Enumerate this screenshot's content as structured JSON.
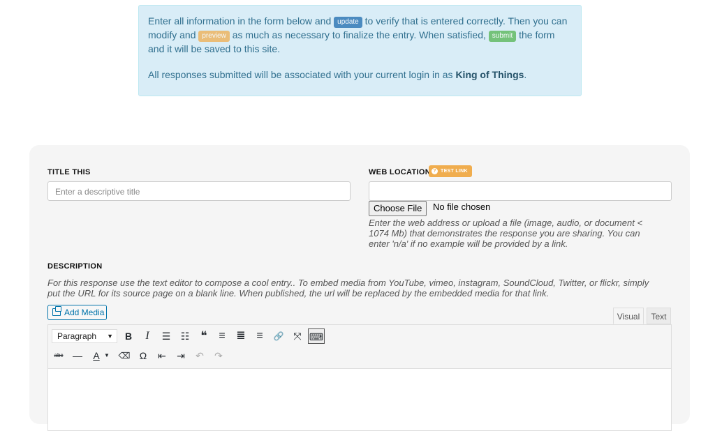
{
  "notice": {
    "line1_a": "Enter all information in the form below and",
    "update": "update",
    "line1_b": "to verify that is entered correctly. Then you can modify and",
    "preview": "preview",
    "line1_c": "as much as necessary to finalize the entry. When satisfied,",
    "submit": "submit",
    "line1_d": "the form and it will be saved to this site.",
    "line2_a": "All responses submitted will be associated with your current login in as",
    "user": "King of Things",
    "line2_b": "."
  },
  "form": {
    "title_label": "TITLE THIS",
    "title_placeholder": "Enter a descriptive title",
    "web_label": "WEB LOCATION",
    "test_link": "TEST LINK",
    "choose_file": "Choose File",
    "no_file": "No file chosen",
    "web_help": "Enter the web address or upload a file (image, audio, or document < 1074 Mb) that demonstrates the response you are sharing. You can enter 'n/a' if no example will be provided by a link.",
    "desc_label": "DESCRIPTION",
    "desc_help": "For this response use the text editor to compose a cool entry.. To embed media from YouTube, vimeo, instagram, SoundCloud, Twitter, or flickr, simply put the URL for its source page on a blank line. When published, the url will be replaced by the embedded media for that link.",
    "add_media": "Add Media",
    "tab_visual": "Visual",
    "tab_text": "Text",
    "format_select": "Paragraph"
  },
  "toolbar_icons": {
    "bold": "B",
    "italic": "I",
    "bullets": "☰",
    "numbered": "☷",
    "quote": "❝",
    "align_left": "≡",
    "align_center": "≣",
    "align_right": "≡",
    "link": "🔗",
    "fullscreen": "⤧",
    "kitchen": "⌨",
    "strike": "abc",
    "hr": "—",
    "color": "A",
    "clear": "⌫",
    "omega": "Ω",
    "outdent": "⇤",
    "indent": "⇥",
    "undo": "↶",
    "redo": "↷"
  }
}
